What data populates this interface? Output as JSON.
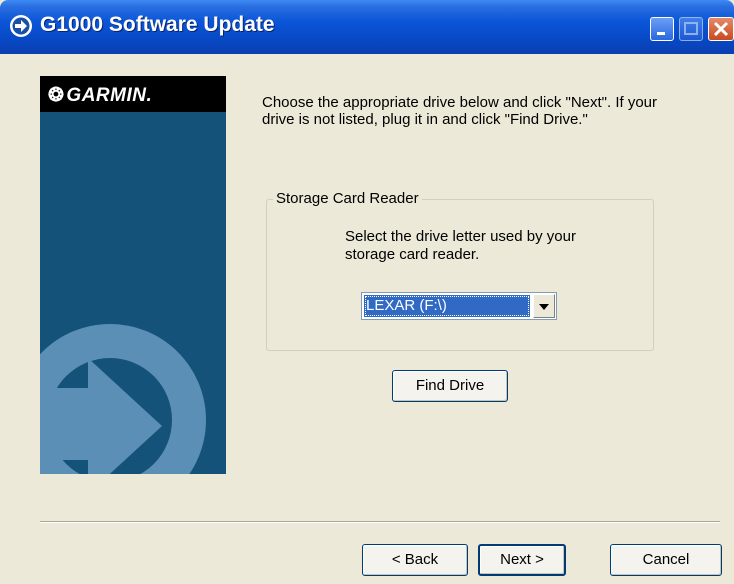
{
  "window": {
    "title": "G1000 Software Update",
    "title_icon": "arrow-circle-icon"
  },
  "banner": {
    "logo_text": "GARMIN.",
    "logo_mark": "❂",
    "art": "arrow-right-icon"
  },
  "instructions": "Choose the appropriate drive below and click \"Next\". If your drive is not listed, plug it in and click \"Find Drive.\"",
  "group": {
    "legend": "Storage Card Reader",
    "prompt": "Select the drive letter used by your storage card reader.",
    "drive_select": {
      "value": "LEXAR (F:\\)"
    }
  },
  "buttons": {
    "find_drive": "Find Drive",
    "back": "< Back",
    "next": "Next >",
    "cancel": "Cancel"
  },
  "colors": {
    "title_bar": "#0a55d8",
    "banner": "#14527a",
    "selection": "#316ac5",
    "face": "#ece9d8"
  }
}
